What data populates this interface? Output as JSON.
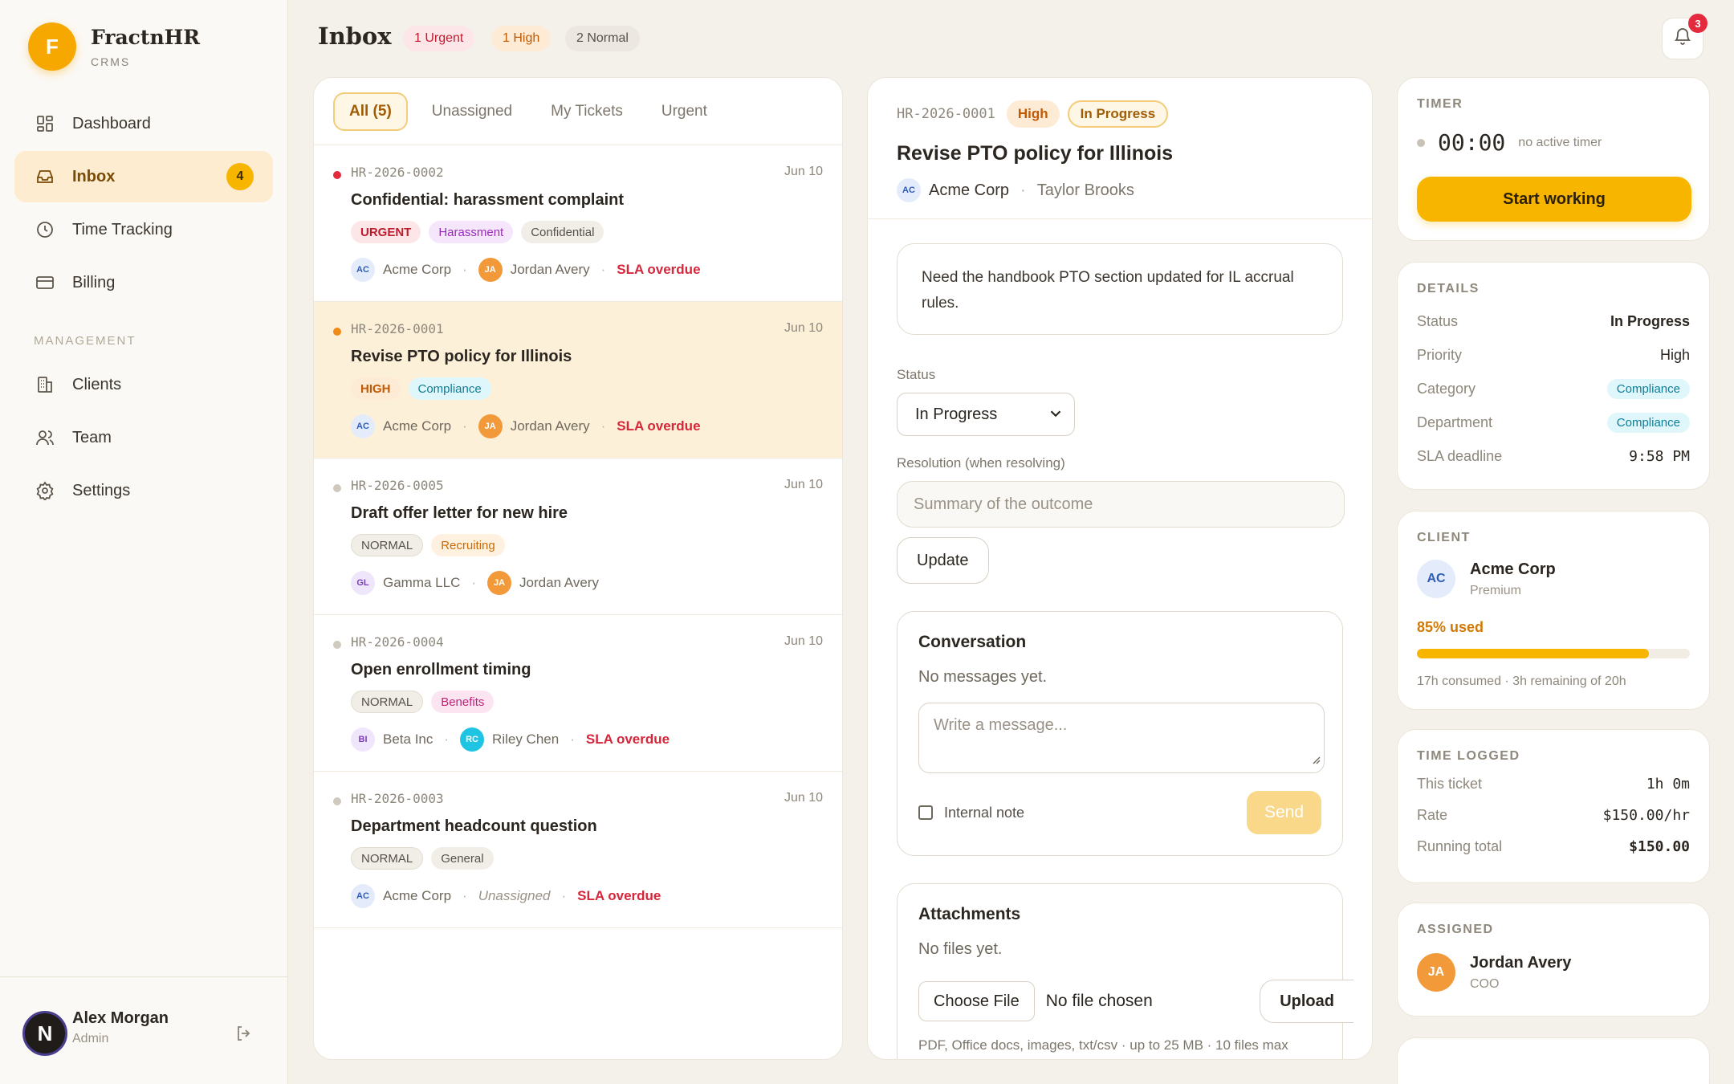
{
  "brand": {
    "logo_letter": "F",
    "name": "FractnHR",
    "sub": "CRMS"
  },
  "nav": {
    "items": [
      {
        "label": "Dashboard",
        "icon": "grid-icon"
      },
      {
        "label": "Inbox",
        "icon": "inbox-icon",
        "badge": "4",
        "active": true
      },
      {
        "label": "Time Tracking",
        "icon": "clock-icon"
      },
      {
        "label": "Billing",
        "icon": "credit-card-icon"
      }
    ],
    "section_label": "MANAGEMENT",
    "management": [
      {
        "label": "Clients",
        "icon": "building-icon"
      },
      {
        "label": "Team",
        "icon": "users-icon"
      },
      {
        "label": "Settings",
        "icon": "gear-icon"
      }
    ]
  },
  "user": {
    "initial": "N",
    "name": "Alex Morgan",
    "role": "Admin"
  },
  "header": {
    "title": "Inbox",
    "pills": {
      "urgent": "1 Urgent",
      "high": "1 High",
      "normal": "2 Normal"
    },
    "notification_count": "3"
  },
  "list": {
    "tabs": [
      "All (5)",
      "Unassigned",
      "My Tickets",
      "Urgent"
    ],
    "tickets": [
      {
        "id": "HR-2026-0002",
        "date": "Jun 10",
        "title": "Confidential: harassment complaint",
        "priority": "URGENT",
        "tags": [
          "Harassment",
          "Confidential"
        ],
        "client": "Acme Corp",
        "client_initials": "AC",
        "assignee": "Jordan Avery",
        "assignee_initials": "JA",
        "sla": "SLA overdue",
        "dot_color": "#e32b3d"
      },
      {
        "id": "HR-2026-0001",
        "date": "Jun 10",
        "title": "Revise PTO policy for Illinois",
        "priority": "HIGH",
        "tags": [
          "Compliance"
        ],
        "client": "Acme Corp",
        "client_initials": "AC",
        "assignee": "Jordan Avery",
        "assignee_initials": "JA",
        "sla": "SLA overdue",
        "dot_color": "#f08a18"
      },
      {
        "id": "HR-2026-0005",
        "date": "Jun 10",
        "title": "Draft offer letter for new hire",
        "priority": "NORMAL",
        "tags": [
          "Recruiting"
        ],
        "client": "Gamma LLC",
        "client_initials": "GL",
        "assignee": "Jordan Avery",
        "assignee_initials": "JA",
        "sla": "",
        "dot_color": "#cfc9be"
      },
      {
        "id": "HR-2026-0004",
        "date": "Jun 10",
        "title": "Open enrollment timing",
        "priority": "NORMAL",
        "tags": [
          "Benefits"
        ],
        "client": "Beta Inc",
        "client_initials": "BI",
        "assignee": "Riley Chen",
        "assignee_initials": "RC",
        "sla": "SLA overdue",
        "dot_color": "#cfc9be"
      },
      {
        "id": "HR-2026-0003",
        "date": "Jun 10",
        "title": "Department headcount question",
        "priority": "NORMAL",
        "tags": [
          "General"
        ],
        "client": "Acme Corp",
        "client_initials": "AC",
        "assignee": "Unassigned",
        "assignee_initials": "",
        "sla": "SLA overdue",
        "dot_color": "#cfc9be"
      }
    ]
  },
  "detail": {
    "id": "HR-2026-0001",
    "priority": "High",
    "status": "In Progress",
    "title": "Revise PTO policy for Illinois",
    "client_initials": "AC",
    "client": "Acme Corp",
    "requester": "Taylor Brooks",
    "description": "Need the handbook PTO section updated for IL accrual rules.",
    "status_label": "Status",
    "status_value": "In Progress",
    "resolution_label": "Resolution (when resolving)",
    "resolution_placeholder": "Summary of the outcome",
    "update_label": "Update",
    "conversation": {
      "title": "Conversation",
      "empty": "No messages yet.",
      "placeholder": "Write a message...",
      "internal_note": "Internal note",
      "send": "Send"
    },
    "attachments": {
      "title": "Attachments",
      "empty": "No files yet.",
      "choose": "Choose File",
      "no_file": "No file chosen",
      "upload": "Upload",
      "hint": "PDF, Office docs, images, txt/csv · up to 25 MB · 10 files max"
    }
  },
  "timer": {
    "title": "TIMER",
    "value": "00:00",
    "note": "no active timer",
    "button": "Start working"
  },
  "details": {
    "title": "DETAILS",
    "rows": [
      {
        "k": "Status",
        "v": "In Progress"
      },
      {
        "k": "Priority",
        "v": "High"
      },
      {
        "k": "Category",
        "v": "Compliance"
      },
      {
        "k": "Department",
        "v": "Compliance"
      },
      {
        "k": "SLA deadline",
        "v": "9:58 PM"
      }
    ]
  },
  "client": {
    "title": "CLIENT",
    "initials": "AC",
    "name": "Acme Corp",
    "tier": "Premium",
    "used": "85% used",
    "used_fraction": 0.85,
    "consumed": "17h consumed · 3h remaining of 20h"
  },
  "time_logged": {
    "title": "TIME LOGGED",
    "rows": [
      {
        "k": "This ticket",
        "v": "1h 0m"
      },
      {
        "k": "Rate",
        "v": "$150.00/hr"
      },
      {
        "k": "Running total",
        "v": "$150.00"
      }
    ]
  },
  "assigned": {
    "title": "ASSIGNED",
    "initials": "JA",
    "name": "Jordan Avery",
    "role": "COO"
  }
}
